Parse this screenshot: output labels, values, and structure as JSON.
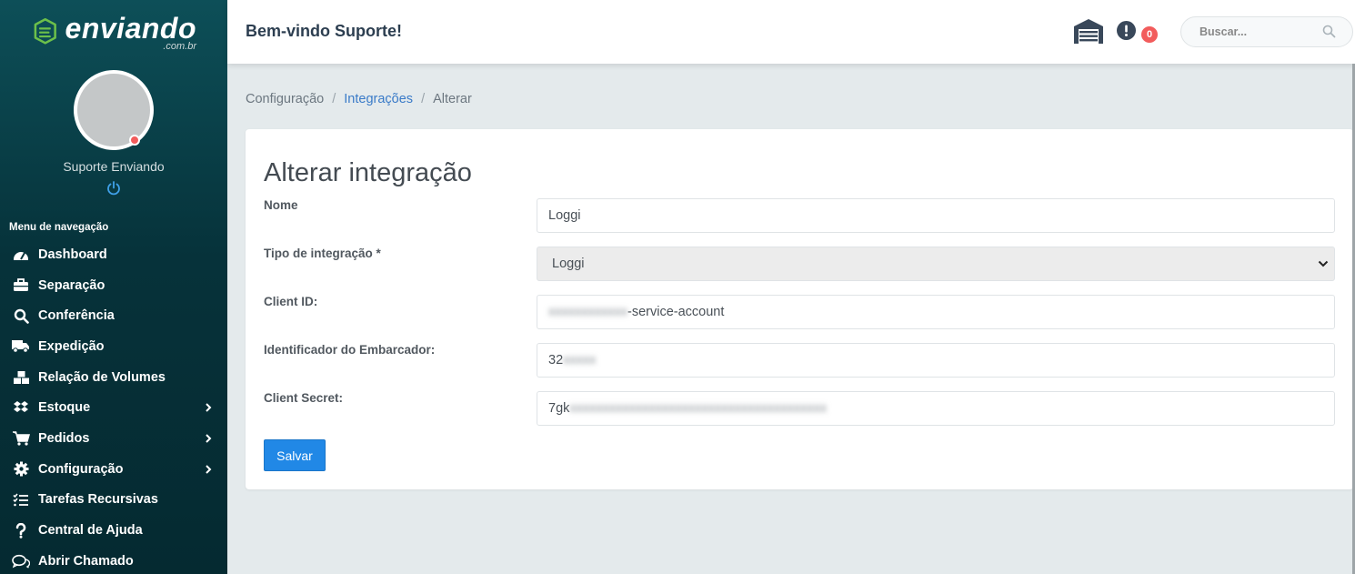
{
  "sidebar": {
    "logo": {
      "name": "enviando",
      "sub": ".com.br"
    },
    "user_name": "Suporte Enviando",
    "nav_header": "Menu de navegação",
    "items": [
      {
        "label": "Dashboard",
        "icon": "dashboard-gauge-icon",
        "has_submenu": false
      },
      {
        "label": "Separação",
        "icon": "toolbox-icon",
        "has_submenu": false
      },
      {
        "label": "Conferência",
        "icon": "search-icon",
        "has_submenu": false
      },
      {
        "label": "Expedição",
        "icon": "truck-icon",
        "has_submenu": false
      },
      {
        "label": "Relação de Volumes",
        "icon": "cubes-icon",
        "has_submenu": false
      },
      {
        "label": "Estoque",
        "icon": "dropbox-icon",
        "has_submenu": true
      },
      {
        "label": "Pedidos",
        "icon": "shopping-cart-icon",
        "has_submenu": true
      },
      {
        "label": "Configuração",
        "icon": "gear-icon",
        "has_submenu": true
      },
      {
        "label": "Tarefas Recursivas",
        "icon": "task-list-icon",
        "has_submenu": false
      },
      {
        "label": "Central de Ajuda",
        "icon": "question-icon",
        "has_submenu": false
      },
      {
        "label": "Abrir Chamado",
        "icon": "chat-icon",
        "has_submenu": false
      }
    ]
  },
  "topbar": {
    "welcome": "Bem-vindo Suporte!",
    "alert_count": "0",
    "search_placeholder": "Buscar..."
  },
  "breadcrumb": {
    "items": [
      "Configuração",
      "Integrações",
      "Alterar"
    ]
  },
  "form": {
    "title": "Alterar integração",
    "fields": {
      "nome": {
        "label": "Nome",
        "value": "Loggi"
      },
      "tipo": {
        "label": "Tipo de integração *",
        "value": "Loggi"
      },
      "client_id": {
        "label": "Client ID:",
        "visible_suffix": "-service-account"
      },
      "embarcador": {
        "label": "Identificador do Embarcador:",
        "visible_prefix": "32"
      },
      "client_secret": {
        "label": "Client Secret:",
        "visible_prefix": "7gk"
      }
    },
    "save_label": "Salvar"
  },
  "colors": {
    "sidebar_bg": "#06323a",
    "accent": "#2188e6",
    "logo_green": "#6cc04a",
    "badge_red": "#f25c5c",
    "link": "#3a7bc8"
  }
}
